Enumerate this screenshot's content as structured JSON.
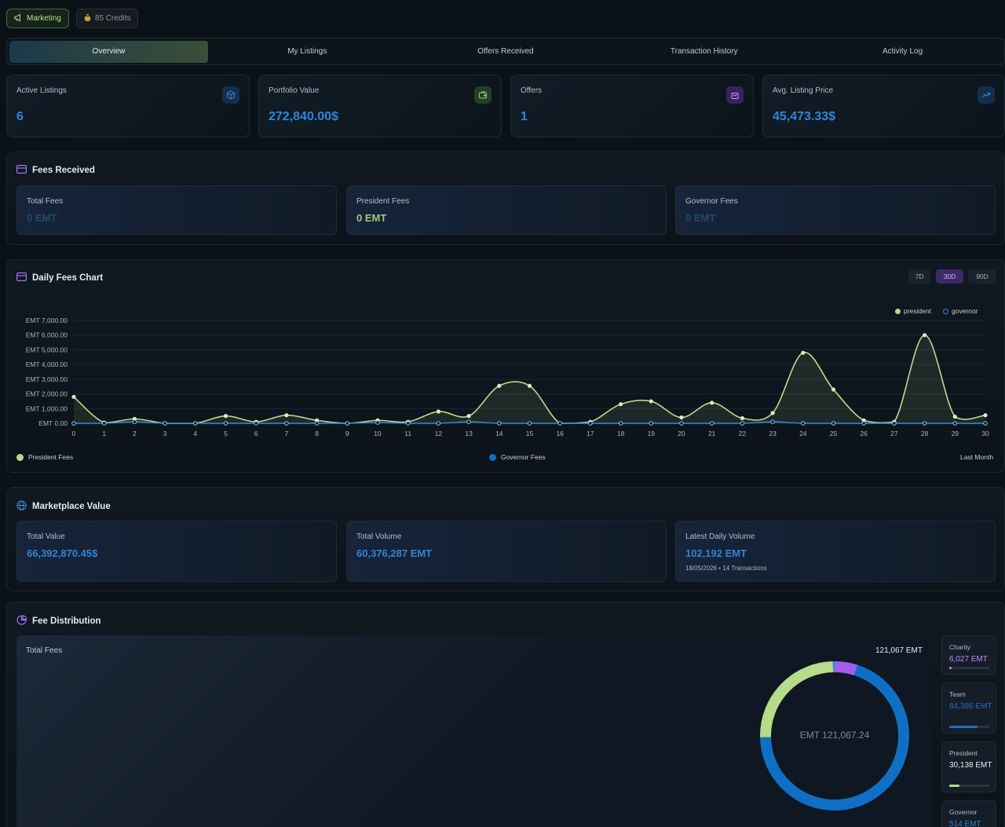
{
  "topbar": {
    "marketing": "Marketing",
    "credits": "85 Credits"
  },
  "tabs": [
    "Overview",
    "My Listings",
    "Offers Received",
    "Transaction History",
    "Activity Log"
  ],
  "stats": [
    {
      "label": "Active Listings",
      "value": "6",
      "icon": "cube-icon",
      "color": "#2f7fd0"
    },
    {
      "label": "Portfolio Value",
      "value": "272,840.00$",
      "icon": "wallet-icon",
      "color": "#8ccf6f"
    },
    {
      "label": "Offers",
      "value": "1",
      "icon": "bag-icon",
      "color": "#b07cff"
    },
    {
      "label": "Avg. Listing Price",
      "value": "45,473.33$",
      "icon": "trending-up-icon",
      "color": "#2f7fd0"
    }
  ],
  "fees_received": {
    "title": "Fees Received",
    "cards": [
      {
        "label": "Total Fees",
        "value": "0 EMT",
        "color": "#244a6e"
      },
      {
        "label": "President Fees",
        "value": "0 EMT",
        "color": "#9bc87d"
      },
      {
        "label": "Governor Fees",
        "value": "0 EMT",
        "color": "#244a6e"
      }
    ]
  },
  "daily_chart": {
    "title": "Daily Fees Chart",
    "ranges": [
      "7D",
      "30D",
      "90D"
    ],
    "active_range": "30D",
    "legend_top": [
      "president",
      "governor"
    ],
    "legend_bottom": [
      "President Fees",
      "Governor Fees"
    ],
    "period_label": "Last Month"
  },
  "chart_data": {
    "type": "area",
    "x": [
      0,
      1,
      2,
      3,
      4,
      5,
      6,
      7,
      8,
      9,
      10,
      11,
      12,
      13,
      14,
      15,
      16,
      17,
      18,
      19,
      20,
      21,
      22,
      23,
      24,
      25,
      26,
      27,
      28,
      29,
      30
    ],
    "y_tick_labels": [
      "EMT 0.00",
      "EMT 1,000.00",
      "EMT 2,000.00",
      "EMT 3,000.00",
      "EMT 4,000.00",
      "EMT 5,000.00",
      "EMT 6,000.00",
      "EMT 7,000.00"
    ],
    "ylim": [
      0,
      7000
    ],
    "series": [
      {
        "name": "president",
        "color": "#b8dc8f",
        "values": [
          1800,
          50,
          300,
          0,
          0,
          500,
          100,
          550,
          200,
          0,
          200,
          100,
          800,
          500,
          2550,
          2550,
          0,
          100,
          1300,
          1500,
          400,
          1400,
          350,
          700,
          4800,
          2300,
          200,
          100,
          6000,
          450,
          550
        ]
      },
      {
        "name": "governor",
        "color": "#3a8ad8",
        "values": [
          0,
          0,
          100,
          0,
          0,
          0,
          0,
          0,
          0,
          0,
          50,
          0,
          0,
          100,
          0,
          0,
          0,
          0,
          0,
          0,
          0,
          0,
          0,
          100,
          0,
          0,
          0,
          0,
          0,
          0,
          0
        ]
      }
    ],
    "grid": true,
    "legend": "top-right"
  },
  "marketplace": {
    "title": "Marketplace Value",
    "cards": [
      {
        "label": "Total Value",
        "value": "66,392,870.45$",
        "sub": ""
      },
      {
        "label": "Total Volume",
        "value": "60,376,287 EMT",
        "sub": ""
      },
      {
        "label": "Latest Daily Volume",
        "value": "102,192 EMT",
        "sub": "18/05/2026 • 14 Transactions"
      }
    ]
  },
  "distribution": {
    "title": "Fee Distribution",
    "card_label": "Total Fees",
    "total_label": "121,067 EMT",
    "center_label": "EMT 121,067.24",
    "donut": [
      {
        "name": "Charity",
        "value": 6027,
        "color": "#a35cf0"
      },
      {
        "name": "Team",
        "value": 84386,
        "color": "#0f6fc4"
      },
      {
        "name": "President",
        "value": 30138,
        "color": "#b4dc8a"
      },
      {
        "name": "Governor",
        "value": 514,
        "color": "#3c8be0"
      }
    ],
    "side": [
      {
        "label": "Charity",
        "value": "6,027 EMT",
        "color": "#b78bff",
        "fill": 0.05
      },
      {
        "label": "Team",
        "value": "84,386 EMT",
        "color": "#1f6fc0",
        "fill": 0.7
      },
      {
        "label": "President",
        "value": "30,138 EMT",
        "color": "#e6eef5",
        "fill": 0.25
      },
      {
        "label": "Governor",
        "value": "514 EMT",
        "color": "#2f7fd0",
        "fill": 0.01
      }
    ]
  }
}
